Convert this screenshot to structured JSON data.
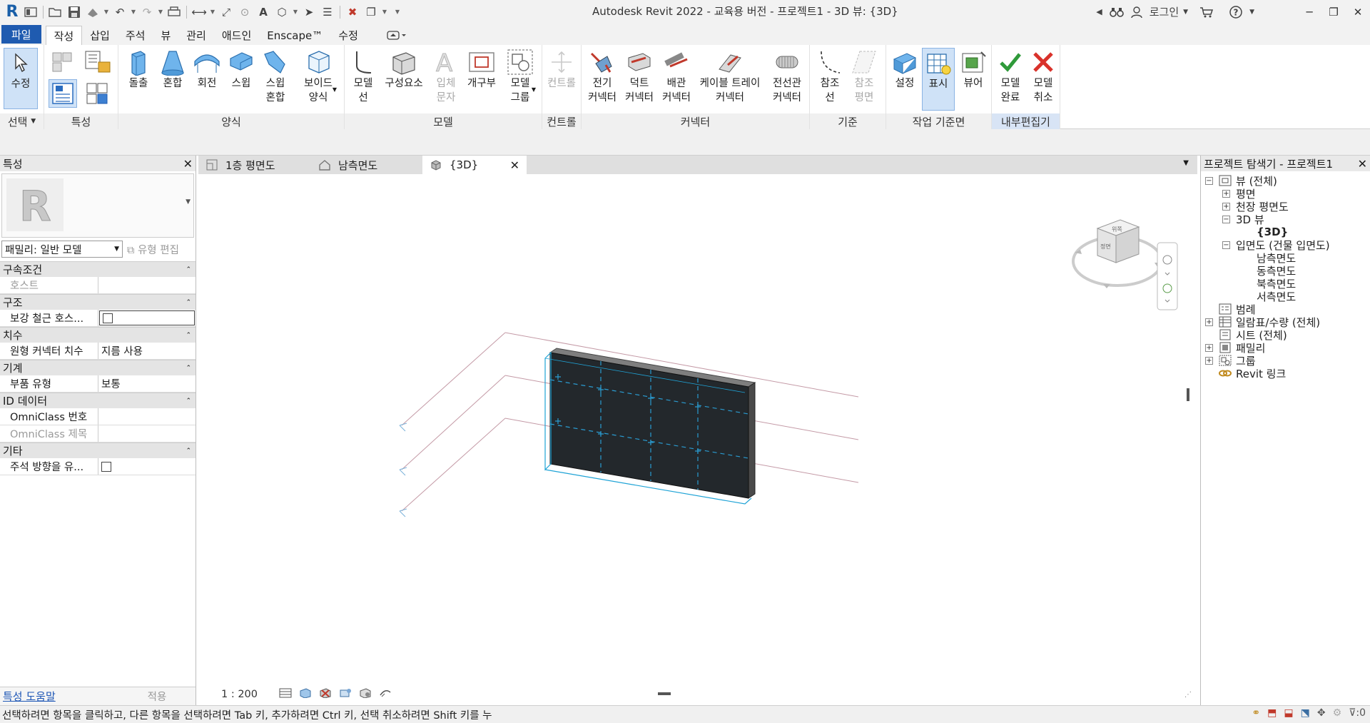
{
  "app": {
    "title": "Autodesk Revit 2022 - 교육용 버전 - 프로젝트1 - 3D 뷰: {3D}",
    "logo_letter": "R",
    "login_label": "로그인"
  },
  "ribbon_tabs": [
    "파일",
    "작성",
    "삽입",
    "주석",
    "뷰",
    "관리",
    "애드인",
    "Enscape™",
    "수정"
  ],
  "ribbon": {
    "panels": {
      "select": "선택",
      "properties": "특성",
      "forms": "양식",
      "model": "모델",
      "control": "컨트롤",
      "connectors": "커넥터",
      "datum": "기준",
      "work_plane": "작업 기준면",
      "in_place_editor": "내부편집기"
    },
    "buttons": {
      "modify": "수정",
      "extrusion": "돌출",
      "blend": "혼합",
      "revolve": "회전",
      "sweep": "스윕",
      "swept_blend": "스윕\n혼합",
      "void_forms": "보이드\n양식",
      "model_line": "모델\n선",
      "component": "구성요소",
      "model_text": "입체\n문자",
      "opening": "개구부",
      "model_group": "모델\n그룹",
      "control": "컨트롤",
      "electrical_connector": "전기\n커넥터",
      "duct_connector": "덕트\n커넥터",
      "pipe_connector": "배관\n커넥터",
      "cable_tray_connector": "케이블 트레이\n커넥터",
      "conduit_connector": "전선관\n커넥터",
      "reference_line": "참조\n선",
      "reference_plane": "참조\n평면",
      "set": "설정",
      "show": "표시",
      "viewer": "뷰어",
      "finish_model": "모델\n완료",
      "cancel_model": "모델\n취소"
    }
  },
  "properties": {
    "title": "특성",
    "family_label": "패밀리: 일반 모델",
    "edit_type": "유형 편집",
    "groups": [
      {
        "name": "구속조건",
        "rows": [
          {
            "name": "호스트",
            "value": "",
            "disabled": true
          }
        ]
      },
      {
        "name": "구조",
        "rows": [
          {
            "name": "보강 철근 호스...",
            "value": "",
            "checkbox": true
          }
        ]
      },
      {
        "name": "치수",
        "rows": [
          {
            "name": "원형 커넥터 치수",
            "value": "지름 사용"
          }
        ]
      },
      {
        "name": "기계",
        "rows": [
          {
            "name": "부품 유형",
            "value": "보통"
          }
        ]
      },
      {
        "name": "ID 데이터",
        "rows": [
          {
            "name": "OmniClass 번호",
            "value": ""
          },
          {
            "name": "OmniClass 제목",
            "value": "",
            "disabled": true
          }
        ]
      },
      {
        "name": "기타",
        "rows": [
          {
            "name": "주석 방향을 유...",
            "value": "",
            "checkbox": true
          }
        ]
      }
    ],
    "help_link": "특성 도움말",
    "apply": "적용"
  },
  "view_tabs": [
    {
      "label": "1층 평면도",
      "icon": "floor-plan-icon"
    },
    {
      "label": "남측면도",
      "icon": "elevation-icon"
    },
    {
      "label": "{3D}",
      "icon": "3d-view-icon",
      "active": true
    }
  ],
  "viewcube": {
    "top_label": "위쪽",
    "front_label": "정면"
  },
  "view_control": {
    "scale": "1 : 200"
  },
  "project_browser": {
    "title": "프로젝트 탐색기 - 프로젝트1",
    "views_root": "뷰 (전체)",
    "floor_plans": "평면",
    "ceiling_plans": "천장 평면도",
    "views_3d": "3D 뷰",
    "view_3d_item": "{3D}",
    "elevations": "입면도 (건물 입면도)",
    "elev_south": "남측면도",
    "elev_east": "동측면도",
    "elev_north": "북측면도",
    "elev_west": "서측면도",
    "legends": "범례",
    "schedules": "일람표/수량 (전체)",
    "sheets": "시트 (전체)",
    "families": "패밀리",
    "groups": "그룹",
    "revit_links": "Revit 링크"
  },
  "status": {
    "text": "선택하려면 항목을 클릭하고, 다른 항목을 선택하려면 Tab 키, 추가하려면 Ctrl 키, 선택 취소하려면 Shift 키를 누",
    "filter_count": ":0"
  }
}
